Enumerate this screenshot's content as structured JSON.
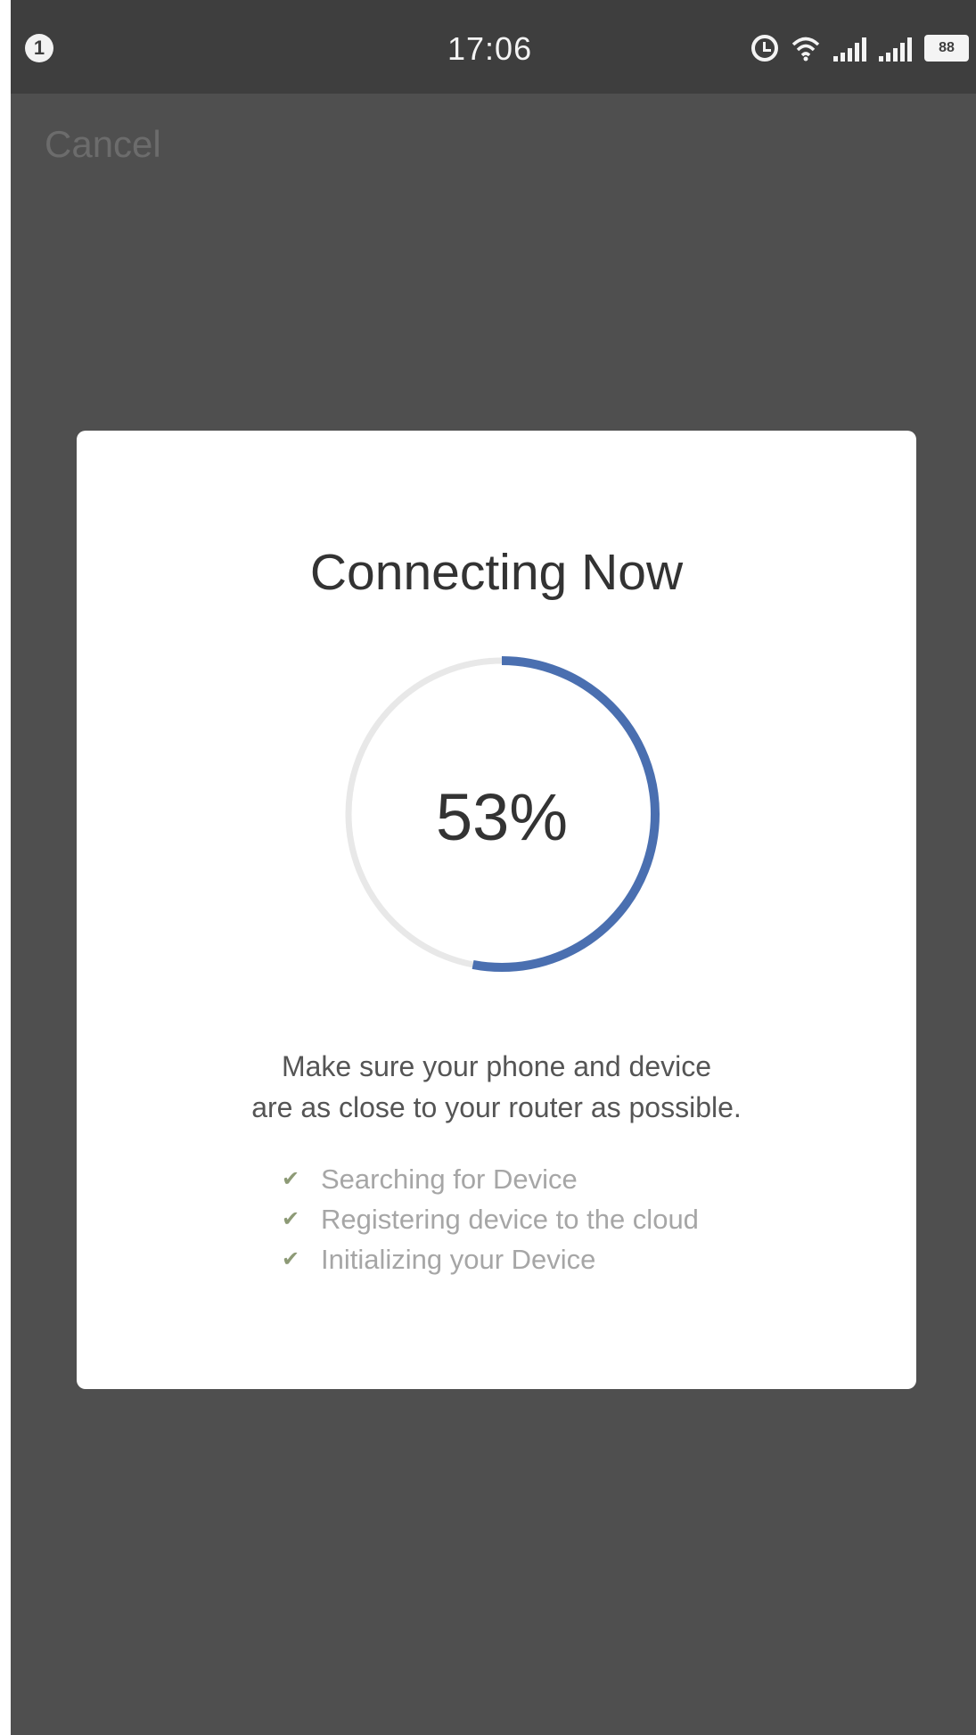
{
  "status_bar": {
    "notification_badge": "1",
    "time": "17:06",
    "icons": [
      "alarm-icon",
      "wifi-icon",
      "signal-icon",
      "signal-icon",
      "battery-icon"
    ],
    "battery_level": "88"
  },
  "header": {
    "cancel_label": "Cancel"
  },
  "dialog": {
    "title": "Connecting Now",
    "progress_percent": 53,
    "progress_label": "53%",
    "hint_line_1": "Make sure your phone and device",
    "hint_line_2": "are as close to your router as possible.",
    "steps": [
      {
        "label": "Searching for Device",
        "icon": "check-icon",
        "done": true
      },
      {
        "label": "Registering device to the cloud",
        "icon": "check-icon",
        "done": true
      },
      {
        "label": "Initializing your Device",
        "icon": "check-icon",
        "done": true
      }
    ]
  },
  "colors": {
    "overlay": "#4f4f4f",
    "status_bar": "#3e3e3e",
    "progress": "#4a6fb0",
    "track": "#e8e8e8",
    "check": "#8d9a76"
  }
}
